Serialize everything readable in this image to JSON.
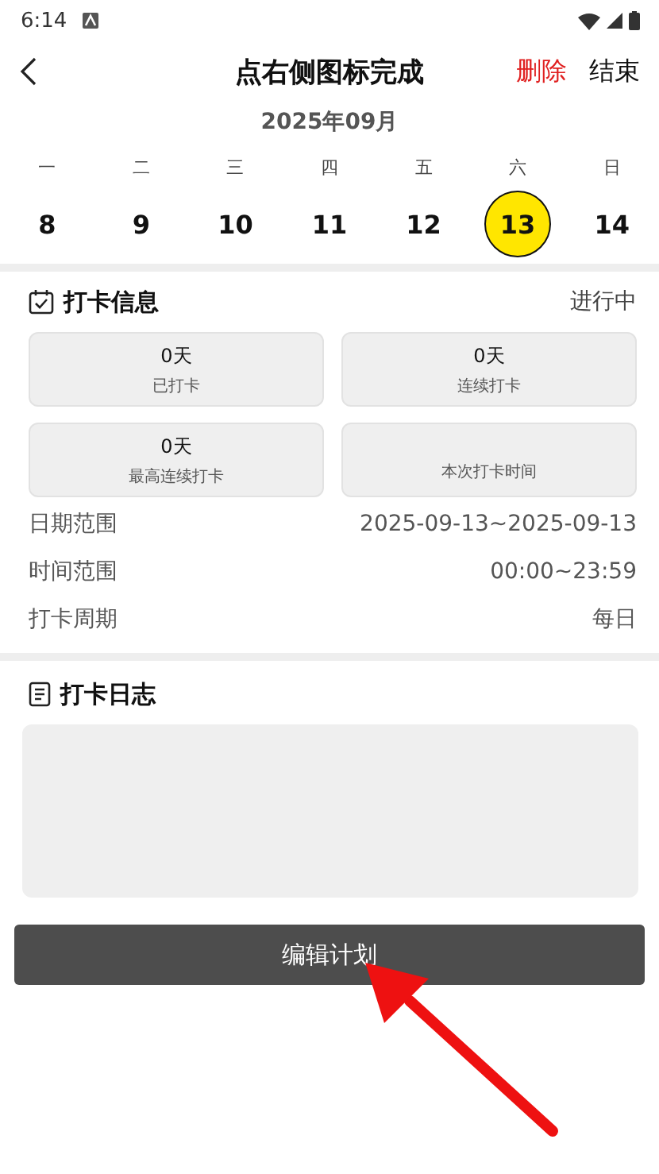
{
  "status_bar": {
    "time": "6:14"
  },
  "header": {
    "title": "点右侧图标完成",
    "actions": [
      {
        "label": "删除",
        "kind": "danger"
      },
      {
        "label": "结束",
        "kind": "normal"
      }
    ]
  },
  "calendar": {
    "month": "2025年09月",
    "weekdays": [
      "一",
      "二",
      "三",
      "四",
      "五",
      "六",
      "日"
    ],
    "days": [
      {
        "label": "8",
        "selected": false
      },
      {
        "label": "9",
        "selected": false
      },
      {
        "label": "10",
        "selected": false
      },
      {
        "label": "11",
        "selected": false
      },
      {
        "label": "12",
        "selected": false
      },
      {
        "label": "13",
        "selected": true
      },
      {
        "label": "14",
        "selected": false
      }
    ]
  },
  "info": {
    "title": "打卡信息",
    "status": "进行中",
    "stats": [
      {
        "value": "0天",
        "label": "已打卡"
      },
      {
        "value": "0天",
        "label": "连续打卡"
      },
      {
        "value": "0天",
        "label": "最高连续打卡"
      },
      {
        "label": "本次打卡时间"
      }
    ],
    "rows": [
      {
        "label": "日期范围",
        "value": "2025-09-13~2025-09-13"
      },
      {
        "label": "时间范围",
        "value": "00:00~23:59"
      },
      {
        "label": "打卡周期",
        "value": "每日"
      }
    ]
  },
  "log": {
    "title": "打卡日志"
  },
  "edit_button": {
    "label": "编辑计划"
  }
}
